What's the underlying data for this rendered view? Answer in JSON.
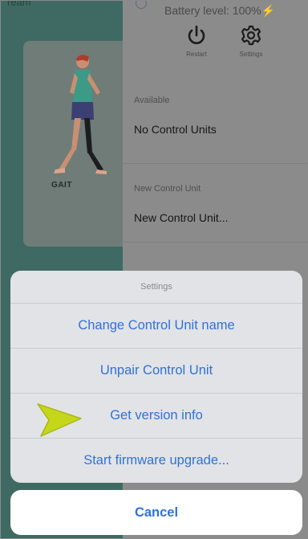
{
  "left_panel": {
    "top_text": "ream",
    "card_label": "GAIT"
  },
  "header": {
    "battery_text": "Battery level: 100%",
    "battery_icon": "lightning-bolt-icon",
    "tools": [
      {
        "label": "Restart",
        "icon": "power-icon"
      },
      {
        "label": "Settings",
        "icon": "gear-icon"
      }
    ]
  },
  "sections": {
    "available_label": "Available",
    "available_value": "No Control Units",
    "new_label": "New Control Unit",
    "new_value": "New Control Unit..."
  },
  "action_sheet": {
    "title": "Settings",
    "items": [
      "Change Control Unit name",
      "Unpair Control Unit",
      "Get version info",
      "Start firmware upgrade..."
    ],
    "cancel": "Cancel"
  },
  "annotation": {
    "icon": "pointer-arrow-icon",
    "color": "#c6d61a"
  },
  "colors": {
    "accent": "#2f72d8",
    "sheet_background": "#e2e3e6"
  }
}
